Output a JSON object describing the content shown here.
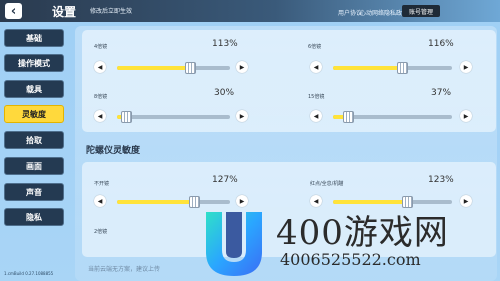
{
  "header": {
    "back_icon": "back-arrow-icon",
    "title": "设置",
    "hint": "修改后立即生效",
    "links": [
      "用户协议",
      "心动网络隐私政策"
    ],
    "account_button": "账号管理"
  },
  "sidebar": {
    "items": [
      {
        "label": "基础",
        "active": false
      },
      {
        "label": "操作模式",
        "active": false
      },
      {
        "label": "载具",
        "active": false
      },
      {
        "label": "灵敏度",
        "active": true
      },
      {
        "label": "拾取",
        "active": false
      },
      {
        "label": "画面",
        "active": false
      },
      {
        "label": "声音",
        "active": false
      },
      {
        "label": "隐私",
        "active": false
      }
    ]
  },
  "scope_sliders": [
    {
      "label": "4倍镜",
      "value": "113%",
      "level": 0.65
    },
    {
      "label": "6倍镜",
      "value": "116%",
      "level": 0.58
    },
    {
      "label": "8倍镜",
      "value": "30%",
      "level": 0.08
    },
    {
      "label": "15倍镜",
      "value": "37%",
      "level": 0.13
    }
  ],
  "gyro": {
    "title": "陀螺仪灵敏度",
    "sliders": [
      {
        "label": "不开镜",
        "value": "127%",
        "level": 0.68
      },
      {
        "label": "红点/全息/机瞄",
        "value": "123%",
        "level": 0.62
      }
    ],
    "next_label": "2倍镜"
  },
  "footer": {
    "hint": "当前云端无方案，建议上传",
    "version": "1.cmBuild 0.27.1088855"
  },
  "watermark": {
    "text": "400游戏网",
    "phone": "4006525522.com"
  },
  "colors": {
    "accent": "#ffd93c",
    "slider_fill": "#ffe33a",
    "sidebar_bg": "#243a52",
    "header_dark": "#2a3a4e"
  }
}
